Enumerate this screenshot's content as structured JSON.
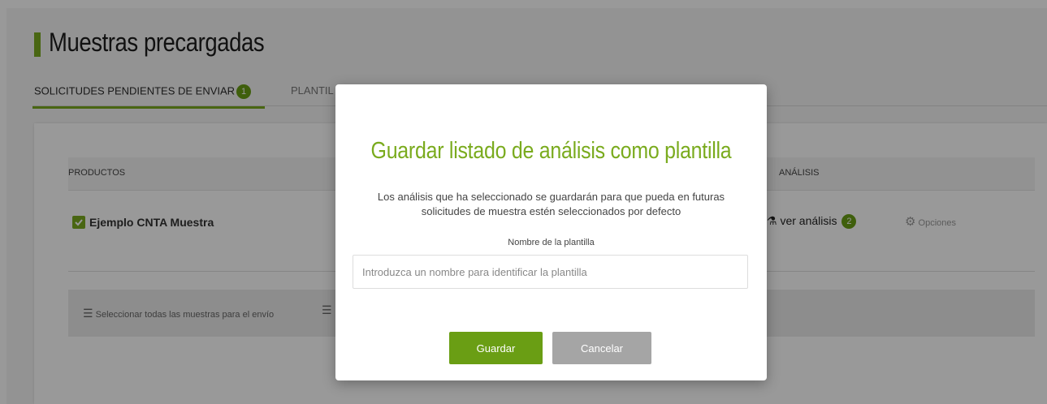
{
  "page": {
    "title": "Muestras precargadas"
  },
  "tabs": [
    {
      "label": "SOLICITUDES PENDIENTES DE ENVIAR",
      "badge": "1"
    },
    {
      "label": "PLANTIL"
    }
  ],
  "table": {
    "headers": [
      "PRODUCTOS",
      "ANÁLISIS"
    ],
    "rows": [
      {
        "product": "Ejemplo CNTA Muestra",
        "analysis_link": "ver análisis",
        "analysis_count": "2",
        "options_label": "Opciones"
      }
    ]
  },
  "actions": {
    "select_all_label": "Seleccionar todas las muestras para el envío"
  },
  "modal": {
    "title": "Guardar listado de análisis como plantilla",
    "description_line1": "Los análisis que ha seleccionado se guardarán para que pueda en futuras",
    "description_line2": "solicitudes de muestra estén seleccionados por defecto",
    "field_label": "Nombre de la plantilla",
    "field_placeholder": "Introduzca un nombre para identificar la plantilla",
    "field_value": "",
    "save_label": "Guardar",
    "cancel_label": "Cancelar"
  },
  "colors": {
    "accent": "#7aab1e",
    "badge": "#6a9e14",
    "cancel": "#a5a5a5"
  },
  "icons": [
    "check-icon",
    "flask-icon",
    "gear-icon",
    "list-icon"
  ]
}
